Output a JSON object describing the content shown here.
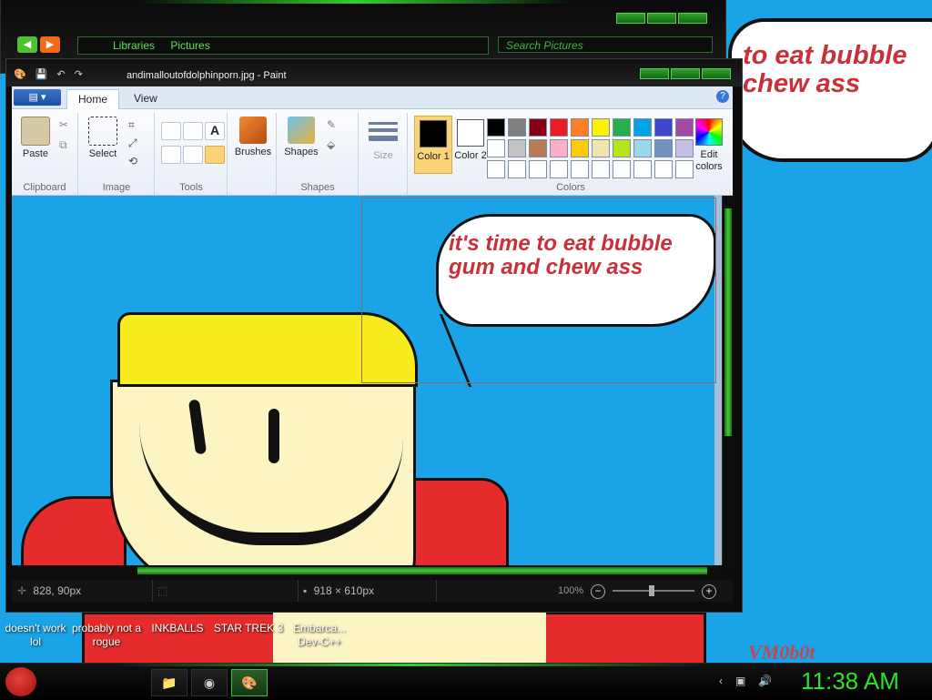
{
  "desktop": {
    "bubble_text": "to eat bubble\nchew ass",
    "tag": "VM0b0t",
    "icons": [
      {
        "label": "doesn't work lol"
      },
      {
        "label": "probably not a rogue"
      },
      {
        "label": "INKBALLS"
      },
      {
        "label": "STAR TREK 3"
      },
      {
        "label": "Embarca... Dev-C++"
      }
    ]
  },
  "explorer": {
    "breadcrumb": [
      "Libraries",
      "Pictures"
    ],
    "search_placeholder": "Search Pictures"
  },
  "paint": {
    "title": "andimalloutofdolphinporn.jpg - Paint",
    "tabs": [
      {
        "label": "Home"
      },
      {
        "label": "View"
      }
    ],
    "ribbon": {
      "clipboard": {
        "title": "Clipboard",
        "paste": "Paste"
      },
      "image": {
        "title": "Image",
        "select": "Select"
      },
      "tools": {
        "title": "Tools"
      },
      "brushes": {
        "label": "Brushes"
      },
      "shapes": {
        "title": "Shapes",
        "label": "Shapes"
      },
      "size": {
        "label": "Size"
      },
      "colors": {
        "title": "Colors",
        "color1": "Color 1",
        "color2": "Color 2",
        "edit": "Edit colors",
        "palette": [
          "#000000",
          "#7f7f7f",
          "#880015",
          "#ed1c24",
          "#ff7f27",
          "#fff200",
          "#22b14c",
          "#00a2e8",
          "#3f48cc",
          "#a349a4",
          "#ffffff",
          "#c3c3c3",
          "#b97a57",
          "#ffaec9",
          "#ffc90e",
          "#efe4b0",
          "#b5e61d",
          "#99d9ea",
          "#7092be",
          "#c8bfe7",
          "#ffffff",
          "#ffffff",
          "#ffffff",
          "#ffffff",
          "#ffffff",
          "#ffffff",
          "#ffffff",
          "#ffffff",
          "#ffffff",
          "#ffffff"
        ]
      }
    },
    "canvas": {
      "bubble_text": "it's time to eat bubble gum and chew ass"
    },
    "status": {
      "cursor_pos": "828, 90px",
      "image_size": "918 × 610px",
      "zoom": "100%"
    }
  },
  "taskbar": {
    "clock": "11:38 AM"
  }
}
